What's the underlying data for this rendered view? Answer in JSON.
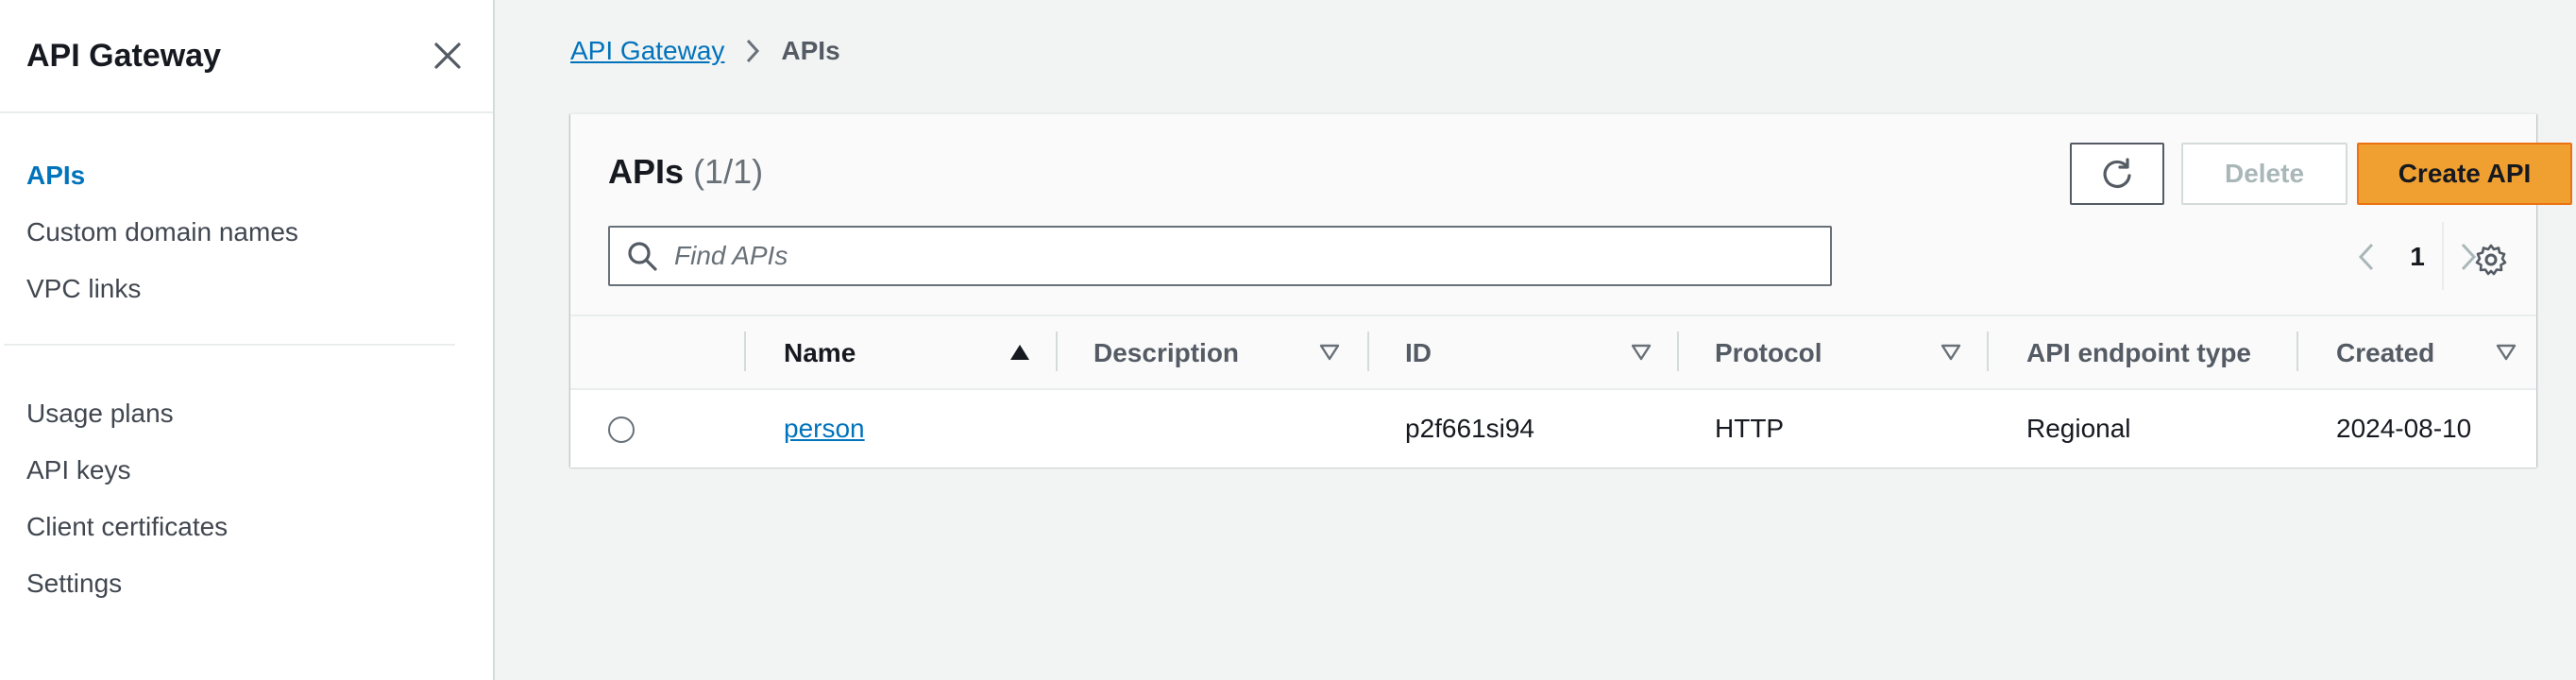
{
  "sidebar": {
    "title": "API Gateway",
    "primary_items": [
      {
        "label": "APIs",
        "active": true
      },
      {
        "label": "Custom domain names",
        "active": false
      },
      {
        "label": "VPC links",
        "active": false
      }
    ],
    "secondary_items": [
      {
        "label": "Usage plans"
      },
      {
        "label": "API keys"
      },
      {
        "label": "Client certificates"
      },
      {
        "label": "Settings"
      }
    ]
  },
  "breadcrumb": {
    "root": "API Gateway",
    "current": "APIs"
  },
  "panel": {
    "title": "APIs",
    "count": "(1/1)",
    "buttons": {
      "delete": "Delete",
      "create": "Create API"
    },
    "search": {
      "placeholder": "Find APIs"
    },
    "pagination": {
      "current_page": "1"
    }
  },
  "table": {
    "columns": [
      {
        "label": "Name",
        "sort": "ascending"
      },
      {
        "label": "Description",
        "sort": "none"
      },
      {
        "label": "ID",
        "sort": "none"
      },
      {
        "label": "Protocol",
        "sort": "none"
      },
      {
        "label": "API endpoint type",
        "sort": "none"
      },
      {
        "label": "Created",
        "sort": "none"
      }
    ],
    "rows": [
      {
        "name": "person",
        "description": "",
        "id": "p2f661si94",
        "protocol": "HTTP",
        "endpoint_type": "Regional",
        "created": "2024-08-10"
      }
    ]
  },
  "colors": {
    "link": "#0073bb",
    "primary_button": "#f0a030",
    "background": "#f2f3f3"
  },
  "icons": [
    "close-icon",
    "chevron-right-icon",
    "refresh-icon",
    "search-icon",
    "chevron-left-icon",
    "gear-icon",
    "sort-ascending-icon",
    "sort-descending-icon"
  ]
}
